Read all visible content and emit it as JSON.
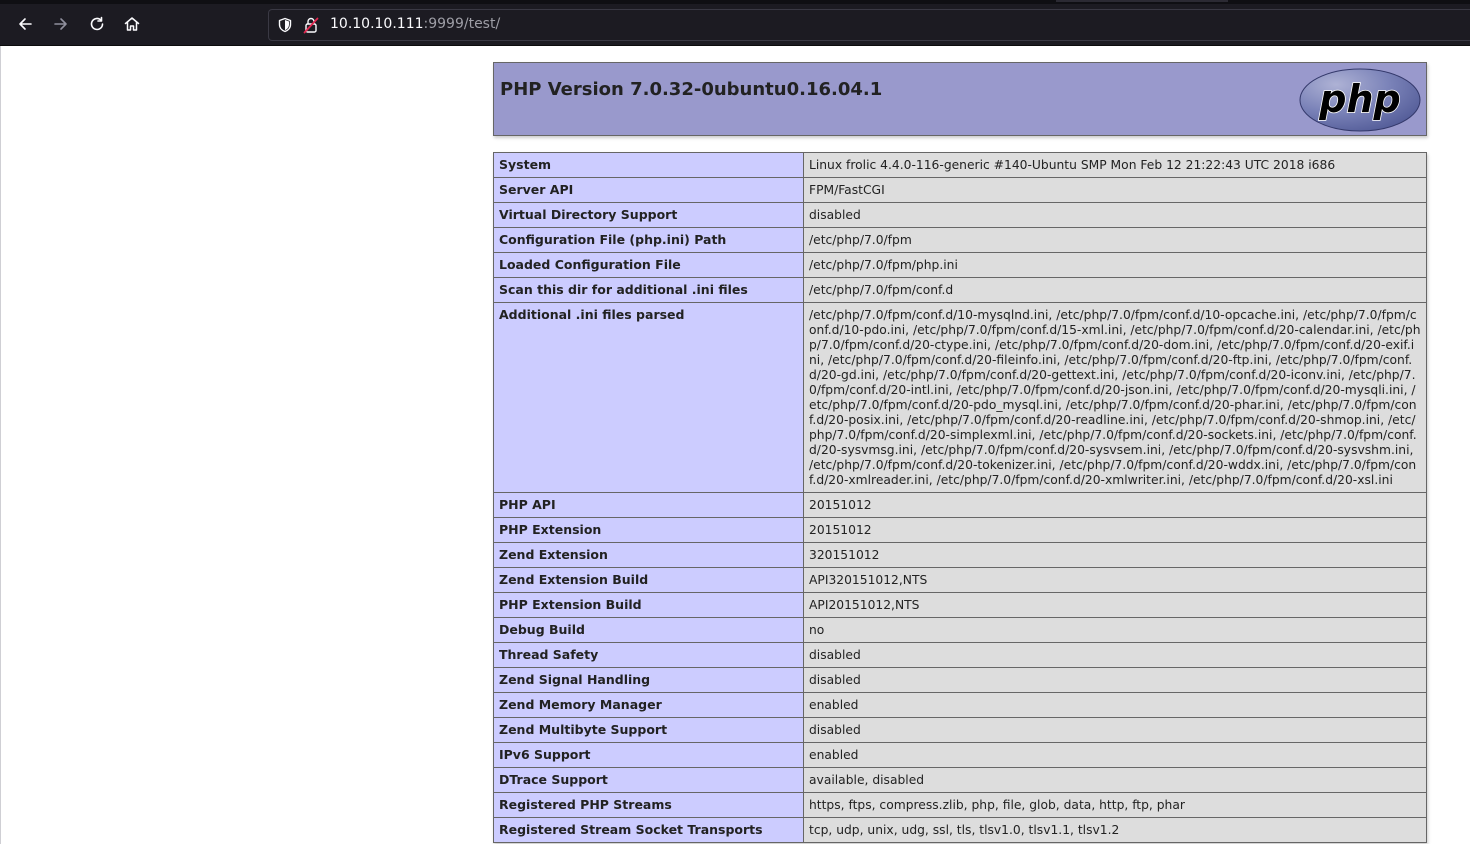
{
  "browser": {
    "url_host": "10.10.10.111",
    "url_rest": ":9999/test/"
  },
  "page": {
    "title": "PHP Version 7.0.32-0ubuntu0.16.04.1",
    "logo_text": "php"
  },
  "rows": [
    {
      "key": "System",
      "value": "Linux frolic 4.4.0-116-generic #140-Ubuntu SMP Mon Feb 12 21:22:43 UTC 2018 i686"
    },
    {
      "key": "Server API",
      "value": "FPM/FastCGI"
    },
    {
      "key": "Virtual Directory Support",
      "value": "disabled"
    },
    {
      "key": "Configuration File (php.ini) Path",
      "value": "/etc/php/7.0/fpm"
    },
    {
      "key": "Loaded Configuration File",
      "value": "/etc/php/7.0/fpm/php.ini"
    },
    {
      "key": "Scan this dir for additional .ini files",
      "value": "/etc/php/7.0/fpm/conf.d"
    },
    {
      "key": "Additional .ini files parsed",
      "value": "/etc/php/7.0/fpm/conf.d/10-mysqlnd.ini, /etc/php/7.0/fpm/conf.d/10-opcache.ini, /etc/php/7.0/fpm/conf.d/10-pdo.ini, /etc/php/7.0/fpm/conf.d/15-xml.ini, /etc/php/7.0/fpm/conf.d/20-calendar.ini, /etc/php/7.0/fpm/conf.d/20-ctype.ini, /etc/php/7.0/fpm/conf.d/20-dom.ini, /etc/php/7.0/fpm/conf.d/20-exif.ini, /etc/php/7.0/fpm/conf.d/20-fileinfo.ini, /etc/php/7.0/fpm/conf.d/20-ftp.ini, /etc/php/7.0/fpm/conf.d/20-gd.ini, /etc/php/7.0/fpm/conf.d/20-gettext.ini, /etc/php/7.0/fpm/conf.d/20-iconv.ini, /etc/php/7.0/fpm/conf.d/20-intl.ini, /etc/php/7.0/fpm/conf.d/20-json.ini, /etc/php/7.0/fpm/conf.d/20-mysqli.ini, /etc/php/7.0/fpm/conf.d/20-pdo_mysql.ini, /etc/php/7.0/fpm/conf.d/20-phar.ini, /etc/php/7.0/fpm/conf.d/20-posix.ini, /etc/php/7.0/fpm/conf.d/20-readline.ini, /etc/php/7.0/fpm/conf.d/20-shmop.ini, /etc/php/7.0/fpm/conf.d/20-simplexml.ini, /etc/php/7.0/fpm/conf.d/20-sockets.ini, /etc/php/7.0/fpm/conf.d/20-sysvmsg.ini, /etc/php/7.0/fpm/conf.d/20-sysvsem.ini, /etc/php/7.0/fpm/conf.d/20-sysvshm.ini, /etc/php/7.0/fpm/conf.d/20-tokenizer.ini, /etc/php/7.0/fpm/conf.d/20-wddx.ini, /etc/php/7.0/fpm/conf.d/20-xmlreader.ini, /etc/php/7.0/fpm/conf.d/20-xmlwriter.ini, /etc/php/7.0/fpm/conf.d/20-xsl.ini"
    },
    {
      "key": "PHP API",
      "value": "20151012"
    },
    {
      "key": "PHP Extension",
      "value": "20151012"
    },
    {
      "key": "Zend Extension",
      "value": "320151012"
    },
    {
      "key": "Zend Extension Build",
      "value": "API320151012,NTS"
    },
    {
      "key": "PHP Extension Build",
      "value": "API20151012,NTS"
    },
    {
      "key": "Debug Build",
      "value": "no"
    },
    {
      "key": "Thread Safety",
      "value": "disabled"
    },
    {
      "key": "Zend Signal Handling",
      "value": "disabled"
    },
    {
      "key": "Zend Memory Manager",
      "value": "enabled"
    },
    {
      "key": "Zend Multibyte Support",
      "value": "disabled"
    },
    {
      "key": "IPv6 Support",
      "value": "enabled"
    },
    {
      "key": "DTrace Support",
      "value": "available, disabled"
    },
    {
      "key": "Registered PHP Streams",
      "value": "https, ftps, compress.zlib, php, file, glob, data, http, ftp, phar"
    },
    {
      "key": "Registered Stream Socket Transports",
      "value": "tcp, udp, unix, udg, ssl, tls, tlsv1.0, tlsv1.1, tlsv1.2"
    }
  ]
}
